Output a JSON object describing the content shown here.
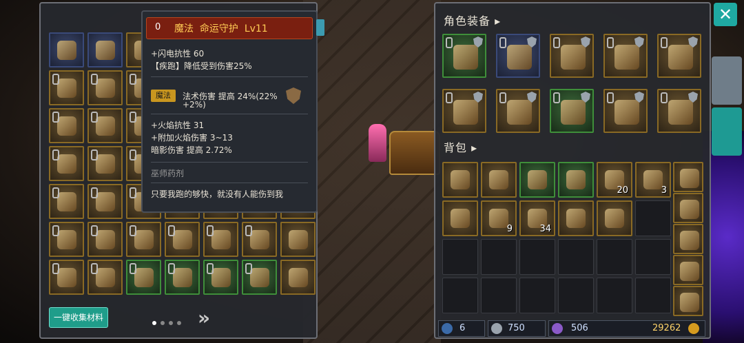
{
  "tooltip": {
    "type": "魔法",
    "name": "命运守护",
    "level": "Lv11",
    "lines1": [
      "+闪电抗性 60",
      "【疾跑】降低受到伤害25%"
    ],
    "tag": "魔法",
    "magic_line": "法术伤害 提高 24%(22%",
    "magic_line2": "+2%)",
    "lines2": [
      "+火焰抗性 31",
      "+附加火焰伤害 3~13",
      "暗影伤害 提高 2.72%"
    ],
    "set_name": "巫师药剂",
    "flavor": "只要我跑的够快，就没有人能伤到我"
  },
  "left_panel": {
    "collect_button": "一键收集材料",
    "page_count": 4,
    "active_page": 0
  },
  "right_panel": {
    "equip_title": "角色装备",
    "bag_title": "背包",
    "bag_counts": [
      "20",
      "3",
      "9",
      "34"
    ],
    "stats": {
      "crystals": "6",
      "helm_value": "750",
      "gems": "506",
      "gold": "29262"
    }
  },
  "colors": {
    "close": "#1fa9a2",
    "collect": "#1f9d8a",
    "tooltip_head": "#7a1f10"
  }
}
